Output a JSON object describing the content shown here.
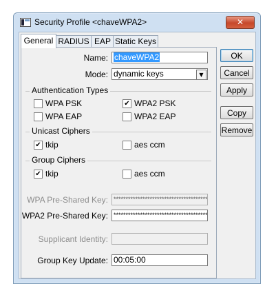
{
  "window": {
    "title": "Security Profile <chaveWPA2>",
    "close_label": "✕"
  },
  "tabs": [
    {
      "label": "General",
      "active": true
    },
    {
      "label": "RADIUS",
      "active": false
    },
    {
      "label": "EAP",
      "active": false
    },
    {
      "label": "Static Keys",
      "active": false
    }
  ],
  "form": {
    "name_label": "Name:",
    "name_value": "chaveWPA2",
    "mode_label": "Mode:",
    "mode_value": "dynamic keys",
    "auth_group": "Authentication Types",
    "auth": {
      "wpa_psk": {
        "label": "WPA PSK",
        "checked": false
      },
      "wpa2_psk": {
        "label": "WPA2 PSK",
        "checked": true
      },
      "wpa_eap": {
        "label": "WPA EAP",
        "checked": false
      },
      "wpa2_eap": {
        "label": "WPA2 EAP",
        "checked": false
      }
    },
    "unicast_group": "Unicast Ciphers",
    "unicast": {
      "tkip": {
        "label": "tkip",
        "checked": true
      },
      "aes": {
        "label": "aes ccm",
        "checked": false
      }
    },
    "group_ciphers_group": "Group Ciphers",
    "group_ciphers": {
      "tkip": {
        "label": "tkip",
        "checked": true
      },
      "aes": {
        "label": "aes ccm",
        "checked": false
      }
    },
    "wpa_key_label": "WPA Pre-Shared Key:",
    "wpa_key_value": "********************************************",
    "wpa2_key_label": "WPA2 Pre-Shared Key:",
    "wpa2_key_value": "********************************************",
    "supplicant_label": "Supplicant Identity:",
    "supplicant_value": "",
    "gku_label": "Group Key Update:",
    "gku_value": "00:05:00"
  },
  "buttons": {
    "ok": "OK",
    "cancel": "Cancel",
    "apply": "Apply",
    "copy": "Copy",
    "remove": "Remove"
  },
  "check_glyph": "✔"
}
